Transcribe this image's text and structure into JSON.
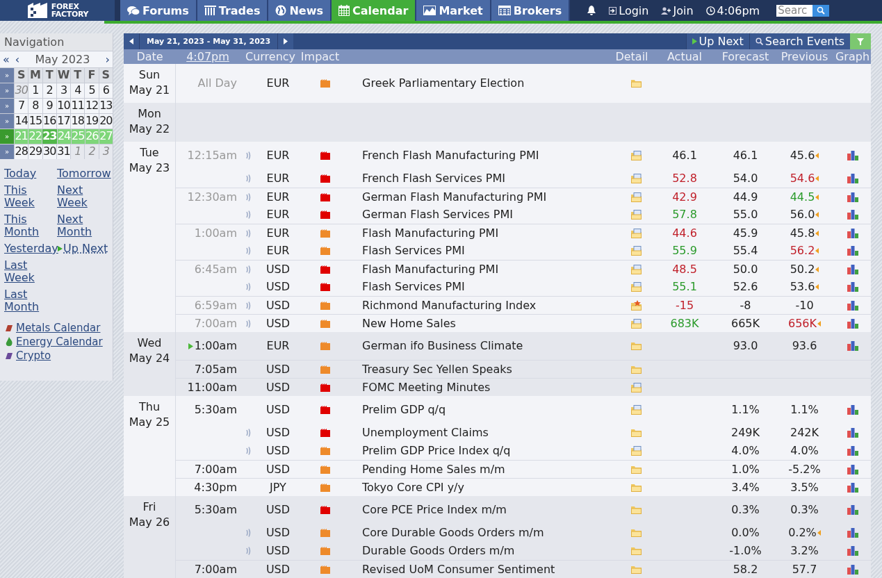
{
  "header": {
    "logo": {
      "line1": "FOREX",
      "line2": "FACTORY"
    },
    "tabs": [
      {
        "label": "Forums",
        "kind": "forums",
        "selected": false
      },
      {
        "label": "Trades",
        "kind": "trades",
        "selected": false
      },
      {
        "label": "News",
        "kind": "news",
        "selected": false
      },
      {
        "label": "Calendar",
        "kind": "calendar",
        "selected": true
      },
      {
        "label": "Market",
        "kind": "market",
        "selected": false
      },
      {
        "label": "Brokers",
        "kind": "brokers",
        "selected": false
      }
    ],
    "login": "Login",
    "join": "Join",
    "time": "4:06pm",
    "search": {
      "placeholder": "Searc"
    }
  },
  "sidebar": {
    "title": "Navigation",
    "prev_year": "«",
    "prev_month": "‹",
    "month": "May 2023",
    "next_month": "›",
    "weekday_selector": "»",
    "weekdays": [
      "S",
      "M",
      "T",
      "W",
      "T",
      "F",
      "S"
    ],
    "weeks": [
      {
        "selector": "»",
        "selected": false,
        "days": [
          {
            "label": "30",
            "other_month": true,
            "today": false
          },
          {
            "label": "1",
            "other_month": false,
            "today": false
          },
          {
            "label": "2",
            "other_month": false,
            "today": false
          },
          {
            "label": "3",
            "other_month": false,
            "today": false
          },
          {
            "label": "4",
            "other_month": false,
            "today": false
          },
          {
            "label": "5",
            "other_month": false,
            "today": false
          },
          {
            "label": "6",
            "other_month": false,
            "today": false
          }
        ]
      },
      {
        "selector": "»",
        "selected": false,
        "days": [
          {
            "label": "7",
            "other_month": false,
            "today": false
          },
          {
            "label": "8",
            "other_month": false,
            "today": false
          },
          {
            "label": "9",
            "other_month": false,
            "today": false
          },
          {
            "label": "10",
            "other_month": false,
            "today": false
          },
          {
            "label": "11",
            "other_month": false,
            "today": false
          },
          {
            "label": "12",
            "other_month": false,
            "today": false
          },
          {
            "label": "13",
            "other_month": false,
            "today": false
          }
        ]
      },
      {
        "selector": "»",
        "selected": false,
        "days": [
          {
            "label": "14",
            "other_month": false,
            "today": false
          },
          {
            "label": "15",
            "other_month": false,
            "today": false
          },
          {
            "label": "16",
            "other_month": false,
            "today": false
          },
          {
            "label": "17",
            "other_month": false,
            "today": false
          },
          {
            "label": "18",
            "other_month": false,
            "today": false
          },
          {
            "label": "19",
            "other_month": false,
            "today": false
          },
          {
            "label": "20",
            "other_month": false,
            "today": false
          }
        ]
      },
      {
        "selector": "»",
        "selected": true,
        "days": [
          {
            "label": "21",
            "other_month": false,
            "today": false
          },
          {
            "label": "22",
            "other_month": false,
            "today": false
          },
          {
            "label": "23",
            "other_month": false,
            "today": true
          },
          {
            "label": "24",
            "other_month": false,
            "today": false
          },
          {
            "label": "25",
            "other_month": false,
            "today": false
          },
          {
            "label": "26",
            "other_month": false,
            "today": false
          },
          {
            "label": "27",
            "other_month": false,
            "today": false
          }
        ]
      },
      {
        "selector": "»",
        "selected": false,
        "days": [
          {
            "label": "28",
            "other_month": false,
            "today": false
          },
          {
            "label": "29",
            "other_month": false,
            "today": false
          },
          {
            "label": "30",
            "other_month": false,
            "today": false
          },
          {
            "label": "31",
            "other_month": false,
            "today": false
          },
          {
            "label": "1",
            "other_month": true,
            "today": false
          },
          {
            "label": "2",
            "other_month": true,
            "today": false
          },
          {
            "label": "3",
            "other_month": true,
            "today": false
          }
        ]
      }
    ],
    "link_rows": [
      [
        {
          "label": "Today",
          "kind": "plain"
        },
        {
          "label": "Tomorrow",
          "kind": "plain"
        }
      ],
      [
        {
          "label": "This Week",
          "kind": "plain"
        },
        {
          "label": "Next Week",
          "kind": "plain"
        }
      ],
      [
        {
          "label": "This Month",
          "kind": "plain"
        },
        {
          "label": "Next Month",
          "kind": "plain"
        }
      ],
      [
        {
          "label": "Yesterday",
          "kind": "plain"
        },
        {
          "label": "Up Next",
          "kind": "up_next"
        }
      ],
      [
        {
          "label": "Last Week",
          "kind": "plain"
        }
      ],
      [
        {
          "label": "Last Month",
          "kind": "plain"
        }
      ]
    ],
    "other_calendars": [
      {
        "label": "Metals Calendar",
        "kind": "metals"
      },
      {
        "label": "Energy Calendar",
        "kind": "energy"
      },
      {
        "label": "Crypto",
        "kind": "crypto"
      }
    ]
  },
  "calendar": {
    "range": "May 21, 2023 - May 31, 2023",
    "up_next": "Up Next",
    "search_events": "Search Events",
    "columns": {
      "date": "Date",
      "time": "4:07pm",
      "currency": "Currency",
      "impact": "Impact",
      "detail": "Detail",
      "actual": "Actual",
      "forecast": "Forecast",
      "previous": "Previous",
      "graph": "Graph"
    },
    "days": [
      {
        "day": "Sun",
        "date": "May 21",
        "events": [
          {
            "time": "All Day",
            "past": true,
            "up_next": false,
            "audio": false,
            "currency": "EUR",
            "high_impact": false,
            "event": "Greek Parliamentary Election",
            "detail_doc": false,
            "starred": false,
            "graph": false
          }
        ]
      },
      {
        "day": "Mon",
        "date": "May 22"
      },
      {
        "day": "Tue",
        "date": "May 23",
        "events": [
          {
            "time": "12:15am",
            "past": true,
            "up_next": false,
            "audio": true,
            "currency": "EUR",
            "high_impact": true,
            "event": "French Flash Manufacturing PMI",
            "detail_doc": true,
            "starred": false,
            "actual": {
              "text": "46.1",
              "color": "#222222"
            },
            "forecast": "46.1",
            "previous": {
              "text": "45.6",
              "color": "#222222"
            },
            "revised": true,
            "graph": true
          },
          {
            "audio": true,
            "currency": "EUR",
            "high_impact": true,
            "event": "French Flash Services PMI",
            "detail_doc": true,
            "starred": false,
            "actual": {
              "text": "52.8",
              "color": "#c0202a"
            },
            "forecast": "54.0",
            "previous": {
              "text": "54.6",
              "color": "#c0202a"
            },
            "revised": true,
            "graph": true
          },
          {
            "time": "12:30am",
            "past": true,
            "up_next": false,
            "audio": true,
            "currency": "EUR",
            "high_impact": true,
            "event": "German Flash Manufacturing PMI",
            "detail_doc": true,
            "starred": false,
            "actual": {
              "text": "42.9",
              "color": "#c0202a"
            },
            "forecast": "44.9",
            "previous": {
              "text": "44.5",
              "color": "#2a9a2a"
            },
            "revised": true,
            "graph": true
          },
          {
            "audio": true,
            "currency": "EUR",
            "high_impact": true,
            "event": "German Flash Services PMI",
            "detail_doc": true,
            "starred": false,
            "actual": {
              "text": "57.8",
              "color": "#2a9a2a"
            },
            "forecast": "55.0",
            "previous": {
              "text": "56.0",
              "color": "#222222"
            },
            "revised": true,
            "graph": true
          },
          {
            "time": "1:00am",
            "past": true,
            "up_next": false,
            "audio": true,
            "currency": "EUR",
            "high_impact": false,
            "event": "Flash Manufacturing PMI",
            "detail_doc": true,
            "starred": false,
            "actual": {
              "text": "44.6",
              "color": "#c0202a"
            },
            "forecast": "45.9",
            "previous": {
              "text": "45.8",
              "color": "#222222"
            },
            "revised": true,
            "graph": true
          },
          {
            "audio": true,
            "currency": "EUR",
            "high_impact": false,
            "event": "Flash Services PMI",
            "detail_doc": true,
            "starred": false,
            "actual": {
              "text": "55.9",
              "color": "#2a9a2a"
            },
            "forecast": "55.4",
            "previous": {
              "text": "56.2",
              "color": "#c0202a"
            },
            "revised": true,
            "graph": true
          },
          {
            "time": "6:45am",
            "past": true,
            "up_next": false,
            "audio": true,
            "currency": "USD",
            "high_impact": true,
            "event": "Flash Manufacturing PMI",
            "detail_doc": true,
            "starred": false,
            "actual": {
              "text": "48.5",
              "color": "#c0202a"
            },
            "forecast": "50.0",
            "previous": {
              "text": "50.2",
              "color": "#222222"
            },
            "revised": true,
            "graph": true
          },
          {
            "audio": true,
            "currency": "USD",
            "high_impact": true,
            "event": "Flash Services PMI",
            "detail_doc": true,
            "starred": false,
            "actual": {
              "text": "55.1",
              "color": "#2a9a2a"
            },
            "forecast": "52.6",
            "previous": {
              "text": "53.6",
              "color": "#222222"
            },
            "revised": true,
            "graph": true
          },
          {
            "time": "6:59am",
            "past": true,
            "up_next": false,
            "audio": true,
            "currency": "USD",
            "high_impact": false,
            "event": "Richmond Manufacturing Index",
            "starred": true,
            "actual": {
              "text": "-15",
              "color": "#c0202a"
            },
            "forecast": "-8",
            "previous": {
              "text": "-10",
              "color": "#222222"
            },
            "revised": false,
            "graph": true
          },
          {
            "time": "7:00am",
            "past": true,
            "up_next": false,
            "audio": true,
            "currency": "USD",
            "high_impact": false,
            "event": "New Home Sales",
            "detail_doc": true,
            "starred": false,
            "actual": {
              "text": "683K",
              "color": "#2a9a2a"
            },
            "forecast": "665K",
            "previous": {
              "text": "656K",
              "color": "#c0202a"
            },
            "revised": true,
            "graph": true
          }
        ]
      },
      {
        "day": "Wed",
        "date": "May 24",
        "events": [
          {
            "time": "1:00am",
            "past": false,
            "up_next": true,
            "audio": false,
            "currency": "EUR",
            "high_impact": false,
            "event": "German ifo Business Climate",
            "detail_doc": false,
            "starred": false,
            "forecast": "93.0",
            "previous": {
              "text": "93.6",
              "color": "#222222"
            },
            "revised": false,
            "graph": true
          },
          {
            "time": "7:05am",
            "past": false,
            "up_next": false,
            "audio": false,
            "currency": "USD",
            "high_impact": false,
            "event": "Treasury Sec Yellen Speaks",
            "detail_doc": false,
            "starred": false,
            "graph": false
          },
          {
            "time": "11:00am",
            "past": false,
            "up_next": false,
            "audio": false,
            "currency": "USD",
            "high_impact": true,
            "event": "FOMC Meeting Minutes",
            "detail_doc": true,
            "starred": false,
            "graph": false
          }
        ]
      },
      {
        "day": "Thu",
        "date": "May 25",
        "events": [
          {
            "time": "5:30am",
            "past": false,
            "up_next": false,
            "audio": false,
            "currency": "USD",
            "high_impact": true,
            "event": "Prelim GDP q/q",
            "detail_doc": true,
            "starred": false,
            "forecast": "1.1%",
            "previous": {
              "text": "1.1%",
              "color": "#222222"
            },
            "revised": false,
            "graph": true
          },
          {
            "audio": true,
            "currency": "USD",
            "high_impact": true,
            "event": "Unemployment Claims",
            "detail_doc": false,
            "starred": false,
            "forecast": "249K",
            "previous": {
              "text": "242K",
              "color": "#222222"
            },
            "revised": false,
            "graph": true
          },
          {
            "audio": true,
            "currency": "USD",
            "high_impact": false,
            "event": "Prelim GDP Price Index q/q",
            "detail_doc": true,
            "starred": false,
            "forecast": "4.0%",
            "previous": {
              "text": "4.0%",
              "color": "#222222"
            },
            "revised": false,
            "graph": true
          },
          {
            "time": "7:00am",
            "past": false,
            "up_next": false,
            "audio": false,
            "currency": "USD",
            "high_impact": false,
            "event": "Pending Home Sales m/m",
            "detail_doc": false,
            "starred": false,
            "forecast": "1.0%",
            "previous": {
              "text": "-5.2%",
              "color": "#222222"
            },
            "revised": false,
            "graph": true
          },
          {
            "time": "4:30pm",
            "past": false,
            "up_next": false,
            "audio": false,
            "currency": "JPY",
            "high_impact": false,
            "event": "Tokyo Core CPI y/y",
            "detail_doc": false,
            "starred": false,
            "forecast": "3.4%",
            "previous": {
              "text": "3.5%",
              "color": "#222222"
            },
            "revised": false,
            "graph": true
          }
        ]
      },
      {
        "day": "Fri",
        "date": "May 26",
        "events": [
          {
            "time": "5:30am",
            "past": false,
            "up_next": false,
            "audio": false,
            "currency": "USD",
            "high_impact": true,
            "event": "Core PCE Price Index m/m",
            "detail_doc": false,
            "starred": false,
            "forecast": "0.3%",
            "previous": {
              "text": "0.3%",
              "color": "#222222"
            },
            "revised": false,
            "graph": true
          },
          {
            "audio": true,
            "currency": "USD",
            "high_impact": false,
            "event": "Core Durable Goods Orders m/m",
            "detail_doc": false,
            "starred": false,
            "forecast": "0.0%",
            "previous": {
              "text": "0.2%",
              "color": "#222222"
            },
            "revised": true,
            "graph": true
          },
          {
            "audio": true,
            "currency": "USD",
            "high_impact": false,
            "event": "Durable Goods Orders m/m",
            "detail_doc": false,
            "starred": false,
            "forecast": "-1.0%",
            "previous": {
              "text": "3.2%",
              "color": "#222222"
            },
            "revised": false,
            "graph": true
          },
          {
            "time": "7:00am",
            "past": false,
            "up_next": false,
            "audio": false,
            "currency": "USD",
            "high_impact": false,
            "event": "Revised UoM Consumer Sentiment",
            "detail_doc": false,
            "starred": false,
            "forecast": "58.2",
            "previous": {
              "text": "57.7",
              "color": "#222222"
            },
            "revised": false,
            "graph": true
          }
        ]
      }
    ]
  }
}
